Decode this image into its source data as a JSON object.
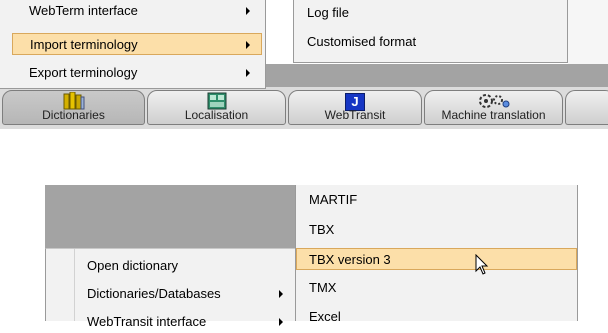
{
  "top_panel": {
    "left_menu": {
      "items": [
        {
          "label": "WebTerm interface",
          "has_submenu": true
        },
        {
          "label": "Import terminology",
          "has_submenu": true,
          "highlighted": true
        },
        {
          "label": "Export terminology",
          "has_submenu": true
        }
      ]
    },
    "right_menu": {
      "items": [
        {
          "label": "Log file"
        },
        {
          "label": "Customised format"
        }
      ]
    },
    "toolbar": {
      "buttons": [
        {
          "label": "Dictionaries",
          "icon": "dictionaries-icon",
          "active": true
        },
        {
          "label": "Localisation",
          "icon": "localisation-icon"
        },
        {
          "label": "WebTransit",
          "icon": "webtransit-icon",
          "icon_text": "J"
        },
        {
          "label": "Machine translation",
          "icon": "gears-icon"
        }
      ]
    }
  },
  "bottom_panel": {
    "left_menu": {
      "items": [
        {
          "label": "Open dictionary",
          "has_submenu": false
        },
        {
          "label": "Dictionaries/Databases",
          "has_submenu": true
        },
        {
          "label": "WebTransit interface",
          "has_submenu": true
        }
      ]
    },
    "right_menu": {
      "items": [
        {
          "label": "MARTIF"
        },
        {
          "label": "TBX"
        },
        {
          "label": "TBX version 3",
          "highlighted": true
        },
        {
          "label": "TMX"
        },
        {
          "label": "Excel"
        }
      ]
    }
  },
  "colors": {
    "highlight": "#fcdfa9",
    "highlight_border": "#d9a85c",
    "menu_bg": "#f2f2f2",
    "grey_bar": "#a3a3a3"
  }
}
